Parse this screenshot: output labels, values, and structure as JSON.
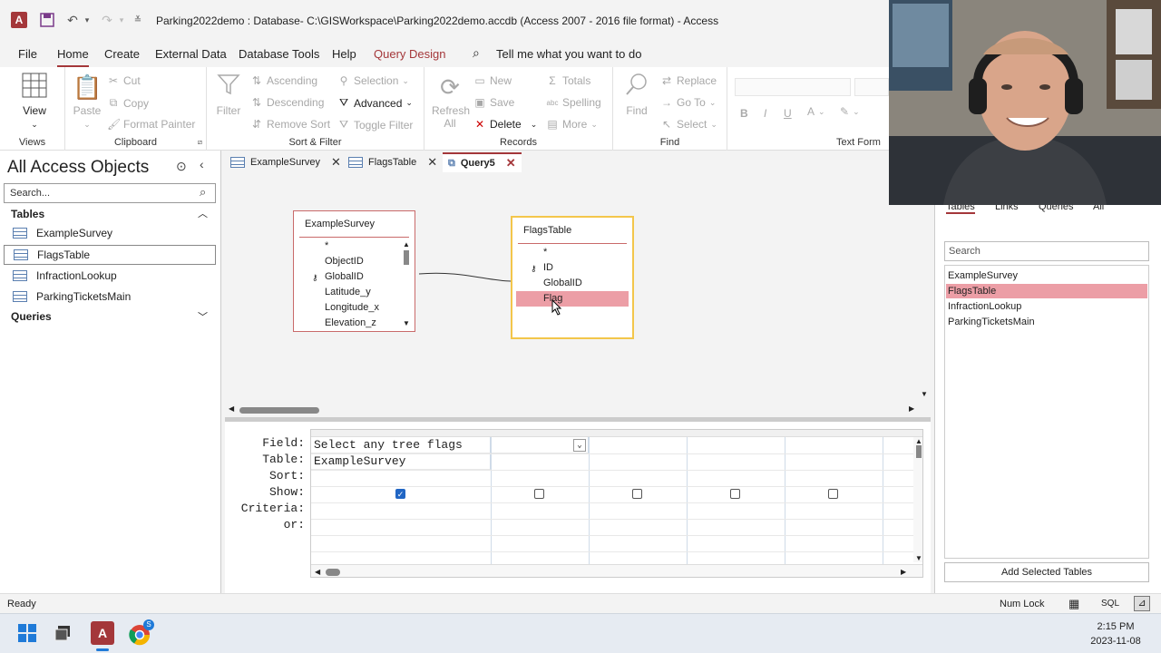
{
  "titlebar": {
    "title": "Parking2022demo : Database- C:\\GISWorkspace\\Parking2022demo.accdb (Access 2007 - 2016 file format)  -  Access",
    "app_logo": "A"
  },
  "menu": {
    "items": [
      "File",
      "Home",
      "Create",
      "External Data",
      "Database Tools",
      "Help",
      "Query Design"
    ],
    "tell_me": "Tell me what you want to do"
  },
  "ribbon": {
    "views": {
      "view": "View",
      "label": "Views"
    },
    "clipboard": {
      "paste": "Paste",
      "cut": "Cut",
      "copy": "Copy",
      "format_painter": "Format Painter",
      "label": "Clipboard"
    },
    "sortfilter": {
      "filter": "Filter",
      "ascending": "Ascending",
      "descending": "Descending",
      "remove_sort": "Remove Sort",
      "selection": "Selection",
      "advanced": "Advanced",
      "toggle_filter": "Toggle Filter",
      "label": "Sort & Filter"
    },
    "records": {
      "refresh": "Refresh",
      "refresh_all": "All",
      "new": "New",
      "save": "Save",
      "delete": "Delete",
      "totals": "Totals",
      "spelling": "Spelling",
      "more": "More",
      "label": "Records"
    },
    "find": {
      "find": "Find",
      "replace": "Replace",
      "goto": "Go To",
      "select": "Select",
      "label": "Find"
    },
    "textformat": {
      "label": "Text Form"
    }
  },
  "nav": {
    "title": "All Access Objects",
    "search_placeholder": "Search...",
    "tables_header": "Tables",
    "queries_header": "Queries",
    "tables": [
      "ExampleSurvey",
      "FlagsTable",
      "InfractionLookup",
      "ParkingTicketsMain"
    ]
  },
  "doctabs": [
    "ExampleSurvey",
    "FlagsTable",
    "Query5"
  ],
  "design": {
    "example_survey": {
      "title": "ExampleSurvey",
      "fields": [
        "*",
        "ObjectID",
        "GlobalID",
        "Latitude_y",
        "Longitude_x",
        "Elevation_z"
      ]
    },
    "flags_table": {
      "title": "FlagsTable",
      "fields": [
        "*",
        "ID",
        "GlobalID",
        "Flag"
      ]
    }
  },
  "grid": {
    "row_labels": [
      "Field:",
      "Table:",
      "Sort:",
      "Show:",
      "Criteria:",
      "or:"
    ],
    "col1_field": "Select any tree flags",
    "col1_table": "ExampleSurvey"
  },
  "showtable": {
    "tabs": [
      "Tables",
      "Links",
      "Queries",
      "All"
    ],
    "search_placeholder": "Search",
    "items": [
      "ExampleSurvey",
      "FlagsTable",
      "InfractionLookup",
      "ParkingTicketsMain"
    ],
    "add_button": "Add Selected Tables"
  },
  "statusbar": {
    "status": "Ready",
    "numlock": "Num Lock",
    "sql": "SQL"
  },
  "taskbar": {
    "time": "2:15 PM",
    "date": "2023-11-08",
    "chrome_badge": "S"
  },
  "colors": {
    "accent": "#a4373a",
    "highlight": "#ec9ea6"
  }
}
